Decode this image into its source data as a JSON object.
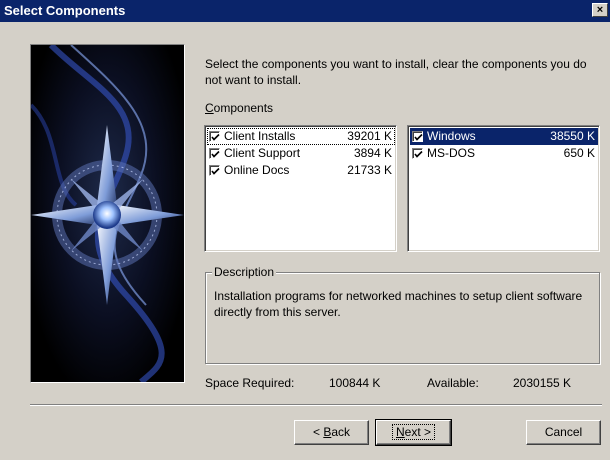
{
  "window": {
    "title": "Select Components",
    "close_label": "×"
  },
  "intro_text": "Select the components you want to install, clear the components you do not want to install.",
  "components": {
    "label_mnemonic": "C",
    "label_rest": "omponents",
    "left_list": [
      {
        "name": "Client Installs",
        "size": "39201 K",
        "checked": true,
        "selected": false,
        "focused": true
      },
      {
        "name": "Client Support",
        "size": "3894 K",
        "checked": true,
        "selected": false,
        "focused": false
      },
      {
        "name": "Online Docs",
        "size": "21733 K",
        "checked": true,
        "selected": false,
        "focused": false
      }
    ],
    "right_list": [
      {
        "name": "Windows",
        "size": "38550 K",
        "checked": true,
        "selected": true,
        "focused": false
      },
      {
        "name": "MS-DOS",
        "size": "650 K",
        "checked": true,
        "selected": false,
        "focused": false
      }
    ]
  },
  "description": {
    "label": "Description",
    "text": "Installation programs for networked machines to setup client software directly from this server."
  },
  "space": {
    "required_label": "Space Required:",
    "required_value": "100844 K",
    "available_label": "Available:",
    "available_value": "2030155 K"
  },
  "buttons": {
    "back_prefix": "< ",
    "back_mnemonic": "B",
    "back_rest": "ack",
    "next_mnemonic": "N",
    "next_rest": "ext >",
    "cancel": "Cancel"
  },
  "colors": {
    "titlebar": "#0a246a",
    "dialog_bg": "#d4d0c8",
    "selection": "#0a246a"
  }
}
